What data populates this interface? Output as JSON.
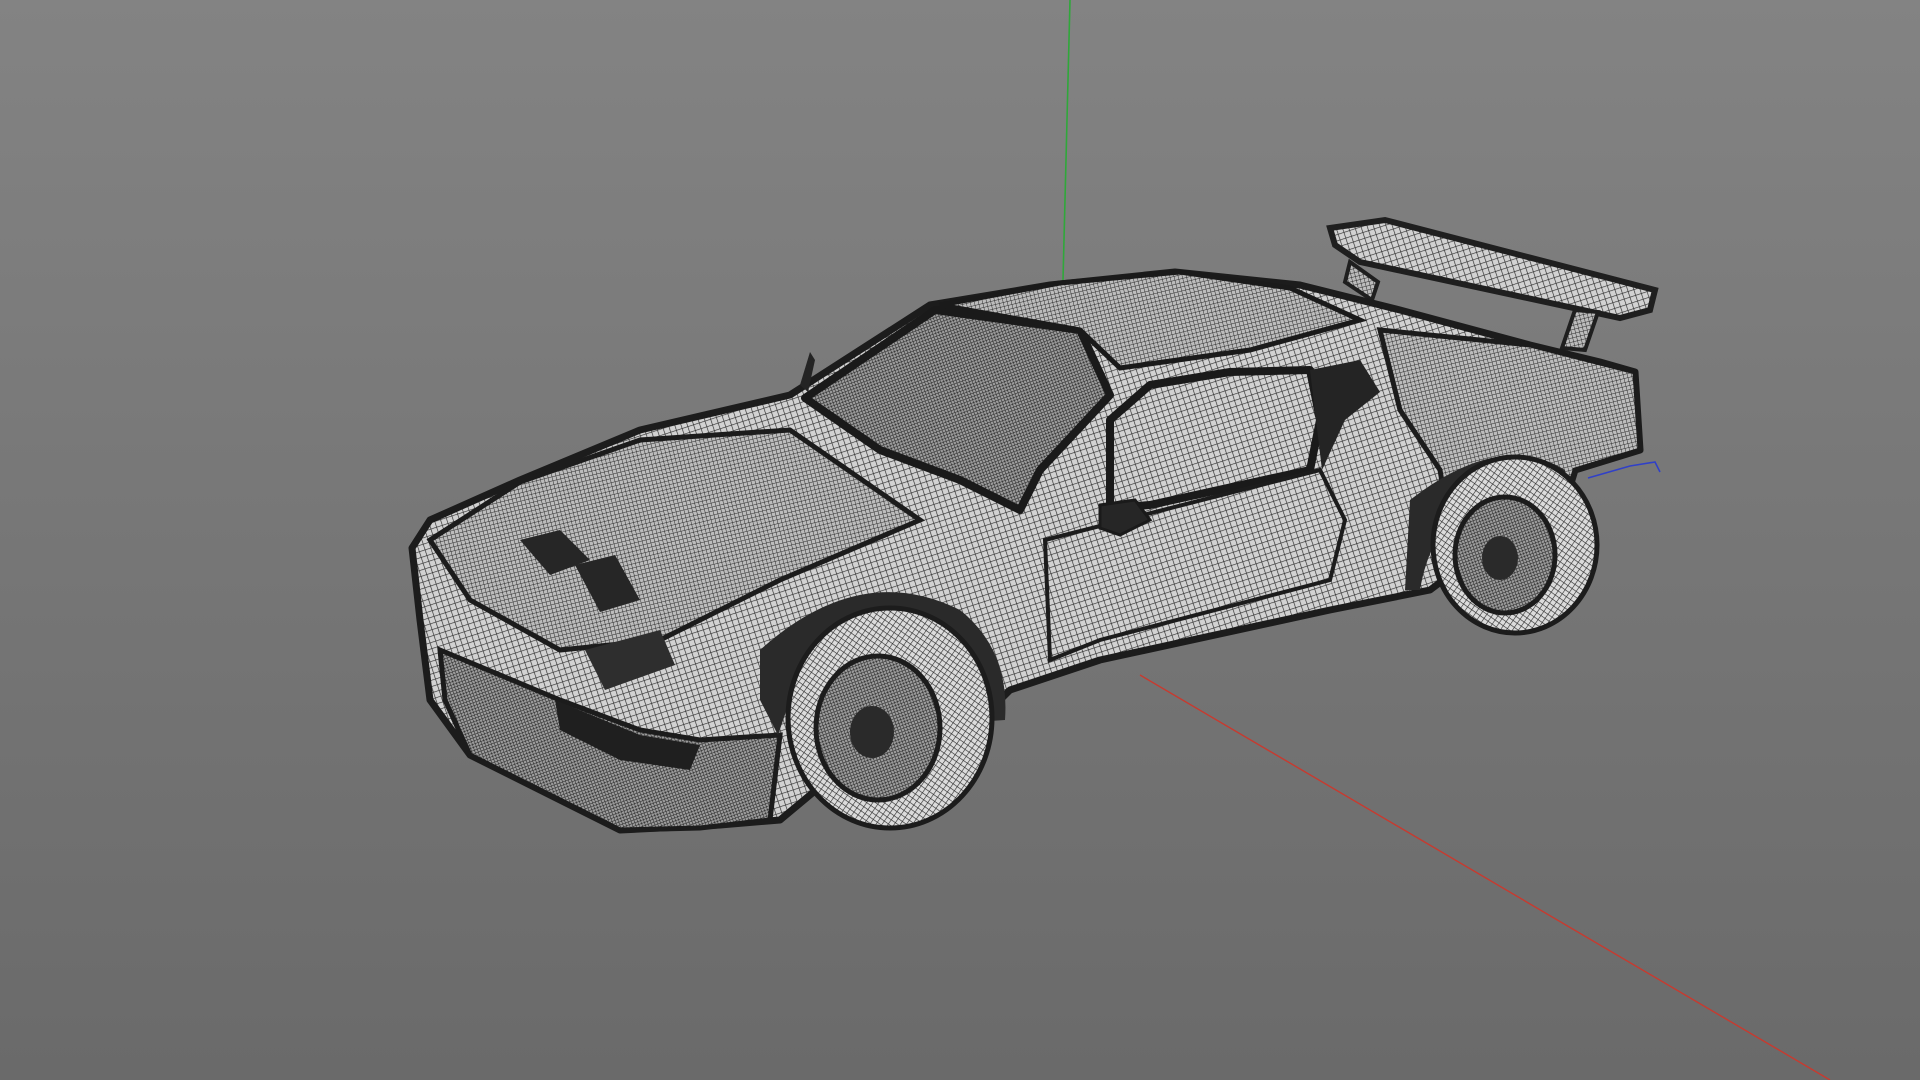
{
  "viewport": {
    "background_top": "#838383",
    "background_bottom": "#6a6a6a",
    "shading_mode": "wireframe",
    "wire_color": "#2a2a2a",
    "mesh_fill": "#cfcfcf"
  },
  "axes": {
    "x_color": "#c83a2f",
    "y_color": "#2fa83a",
    "z_color": "#3040c8"
  },
  "model": {
    "subject": "sports car",
    "icon": "car-wireframe-icon"
  }
}
